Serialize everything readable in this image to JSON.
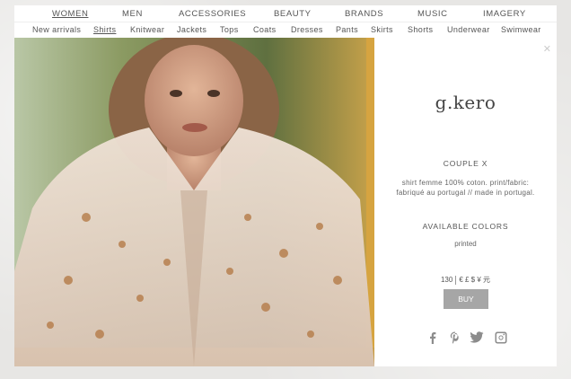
{
  "main_nav": [
    {
      "label": "WOMEN",
      "active": true
    },
    {
      "label": "MEN",
      "active": false
    },
    {
      "label": "ACCESSORIES",
      "active": false
    },
    {
      "label": "BEAUTY",
      "active": false
    },
    {
      "label": "BRANDS",
      "active": false
    },
    {
      "label": "MUSIC",
      "active": false
    },
    {
      "label": "IMAGERY",
      "active": false
    }
  ],
  "sub_nav": [
    {
      "label": "New arrivals",
      "active": false
    },
    {
      "label": "Shirts",
      "active": true
    },
    {
      "label": "Knitwear",
      "active": false
    },
    {
      "label": "Jackets",
      "active": false
    },
    {
      "label": "Tops",
      "active": false
    },
    {
      "label": "Coats",
      "active": false
    },
    {
      "label": "Dresses",
      "active": false
    },
    {
      "label": "Pants",
      "active": false
    },
    {
      "label": "Skirts",
      "active": false
    },
    {
      "label": "Shorts",
      "active": false
    },
    {
      "label": "Underwear",
      "active": false
    },
    {
      "label": "Swimwear",
      "active": false
    }
  ],
  "product": {
    "brand": "g.kero",
    "name": "COUPLE X",
    "description": "shirt femme 100% coton. print/fabric: fabriqué au portugal // made in portugal.",
    "colors_heading": "AVAILABLE COLORS",
    "color_value": "printed",
    "price": "130",
    "currencies": "€ £ $ ¥ 元",
    "buy_label": "BUY"
  },
  "social": [
    "facebook-icon",
    "pinterest-icon",
    "twitter-icon",
    "instagram-icon"
  ],
  "colors": {
    "button": "#a6a6a6",
    "icon": "#8c8c8c"
  }
}
